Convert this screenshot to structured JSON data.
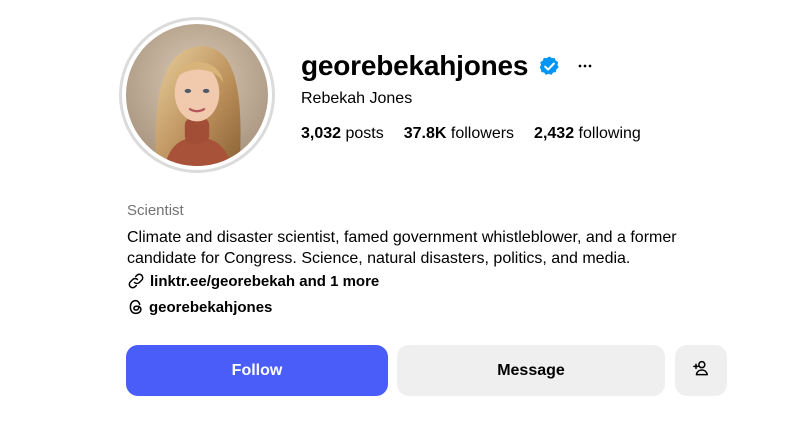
{
  "profile": {
    "username": "georebekahjones",
    "full_name": "Rebekah Jones",
    "verified": true,
    "verified_icon": "verified-badge-icon",
    "accent_color": "#0095f6",
    "stats": {
      "posts_count": "3,032",
      "posts_label": "posts",
      "followers_count": "37.8K",
      "followers_label": "followers",
      "following_count": "2,432",
      "following_label": "following"
    },
    "category": "Scientist",
    "bio": "Climate and disaster scientist, famed government whistleblower, and a former candidate for Congress. Science, natural disasters, politics, and media.",
    "link_text": "linktr.ee/georebekah and 1 more",
    "threads_handle": "georebekahjones"
  },
  "actions": {
    "follow_label": "Follow",
    "message_label": "Message",
    "follow_color": "#4a5df9",
    "secondary_color": "#efefef"
  }
}
